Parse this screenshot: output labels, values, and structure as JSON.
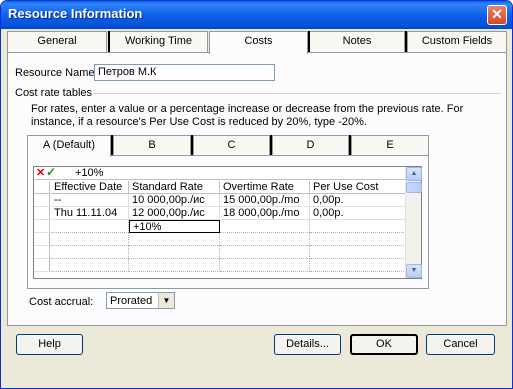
{
  "window": {
    "title": "Resource Information",
    "close_glyph": "✕"
  },
  "tabs": [
    "General",
    "Working Time",
    "Costs",
    "Notes",
    "Custom Fields"
  ],
  "resource": {
    "name_label": "Resource Name:",
    "name_value": "Петров М.К"
  },
  "cost_tables": {
    "group_label": "Cost rate tables",
    "info_line1": "For rates, enter a value or a percentage increase or decrease from the previous rate. For",
    "info_line2": "instance, if a resource's Per Use Cost is reduced by 20%, type -20%.",
    "tabs": [
      "A (Default)",
      "B",
      "C",
      "D",
      "E"
    ],
    "edit_value": "+10%",
    "columns": [
      "Effective Date",
      "Standard Rate",
      "Overtime Rate",
      "Per Use Cost"
    ],
    "rows": [
      [
        "--",
        "10 000,00р./ис",
        "15 000,00р./mo",
        "0,00р."
      ],
      [
        "Thu 11.11.04",
        "12 000,00р./ис",
        "18 000,00р./mo",
        "0,00р."
      ],
      [
        "",
        "+10%",
        "",
        ""
      ]
    ]
  },
  "accrual": {
    "label": "Cost accrual:",
    "value": "Prorated"
  },
  "buttons": {
    "help": "Help",
    "details": "Details...",
    "ok": "OK",
    "cancel": "Cancel"
  },
  "icons": {
    "cancel": "✕",
    "accept": "✓",
    "scroll_up": "▲",
    "scroll_down": "▼",
    "dropdown": "▼"
  }
}
